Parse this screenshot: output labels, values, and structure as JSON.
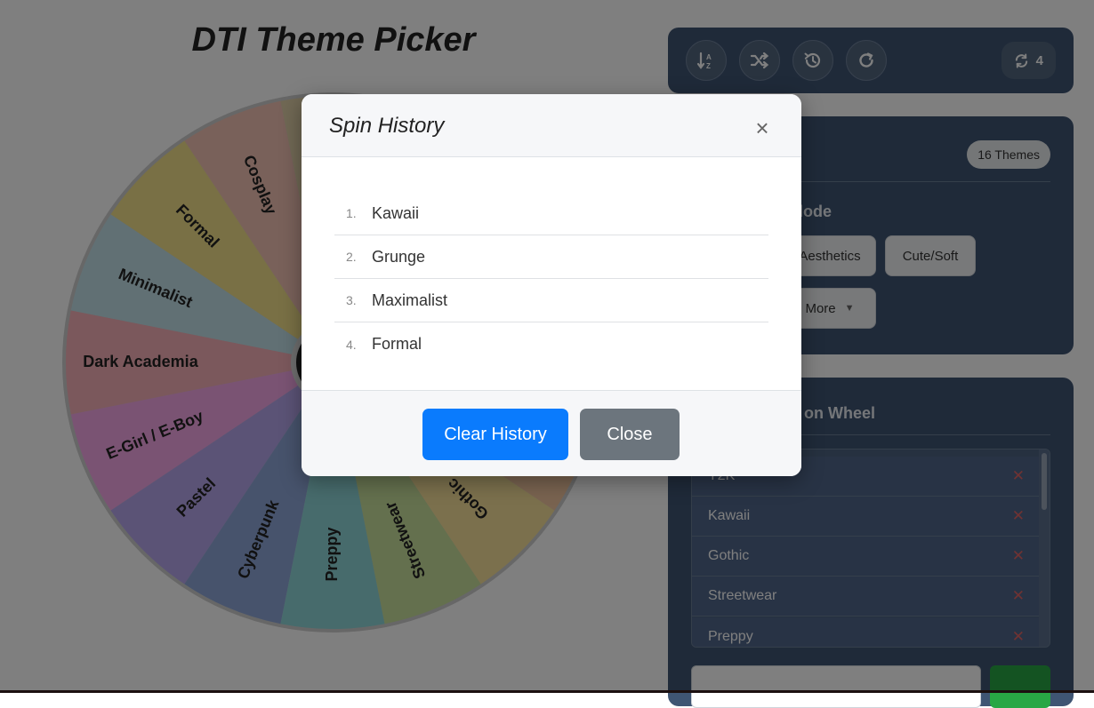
{
  "page": {
    "title": "DTI Theme Picker"
  },
  "wheel": {
    "segments": [
      "Cosplay",
      "Formal",
      "Minimalist",
      "Dark Academia",
      "E-Girl / E-Boy",
      "Pastel",
      "Cyberpunk",
      "Preppy",
      "Streetwear",
      "Gothic",
      "",
      "",
      "",
      "",
      "",
      ""
    ],
    "colors": [
      "#f2c3b5",
      "#f2e18a",
      "#c3e1e8",
      "#f7b1b8",
      "#f4a7e6",
      "#b7a6ec",
      "#8fa7d9",
      "#8fd6d9",
      "#c8e09c",
      "#f7e09a",
      "#f3c7a0",
      "#f6d5a8",
      "#d8e8a0",
      "#bfe0c0",
      "#cfe6a0",
      "#e0d0a8"
    ]
  },
  "toolbar": {
    "buttons": [
      {
        "icon": "sort-alpha-icon"
      },
      {
        "icon": "shuffle-icon"
      },
      {
        "icon": "history-icon"
      },
      {
        "icon": "redo-icon"
      }
    ],
    "spin_count": "4",
    "spin_icon": "refresh-icon"
  },
  "mode_panel": {
    "badge": "16 Themes",
    "heading_partial": "lode",
    "chips": {
      "aesthetics": "Aesthetics",
      "cute_soft": "Cute/Soft",
      "more": "More"
    }
  },
  "list_panel": {
    "heading_partial": "s on Wheel",
    "items": [
      "Y2K",
      "Kawaii",
      "Gothic",
      "Streetwear",
      "Preppy"
    ]
  },
  "modal": {
    "title": "Spin History",
    "history": [
      {
        "num": "1.",
        "name": "Kawaii"
      },
      {
        "num": "2.",
        "name": "Grunge"
      },
      {
        "num": "3.",
        "name": "Maximalist"
      },
      {
        "num": "4.",
        "name": "Formal"
      }
    ],
    "clear_label": "Clear History",
    "close_label": "Close"
  }
}
